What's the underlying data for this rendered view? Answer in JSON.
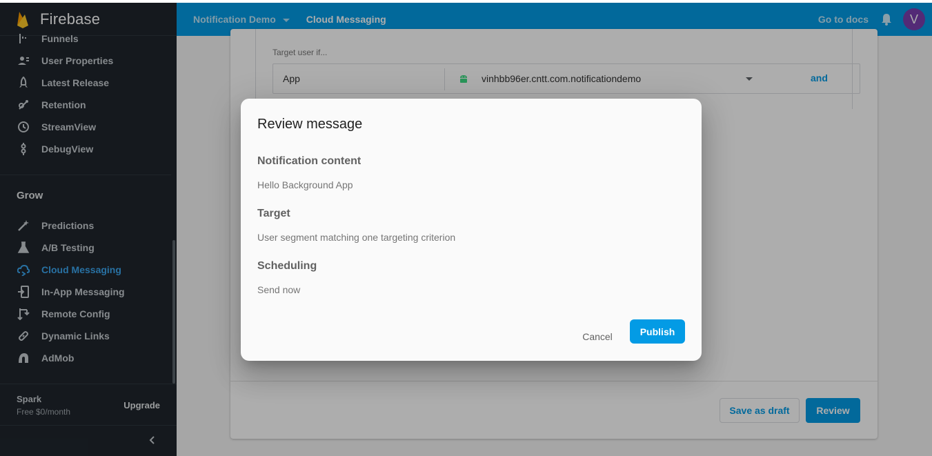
{
  "app": {
    "name": "Firebase"
  },
  "header": {
    "project": "Notification Demo",
    "breadcrumb": "Cloud Messaging",
    "docs_link": "Go to docs",
    "avatar_letter": "V"
  },
  "sidebar": {
    "items_top": [
      {
        "label": "Funnels",
        "icon": "funnel-icon"
      },
      {
        "label": "User Properties",
        "icon": "user-properties-icon"
      },
      {
        "label": "Latest Release",
        "icon": "rocket-icon"
      },
      {
        "label": "Retention",
        "icon": "retention-icon"
      },
      {
        "label": "StreamView",
        "icon": "clock-icon"
      },
      {
        "label": "DebugView",
        "icon": "debug-icon"
      }
    ],
    "grow_title": "Grow",
    "items_grow": [
      {
        "label": "Predictions",
        "icon": "magic-wand-icon"
      },
      {
        "label": "A/B Testing",
        "icon": "flask-icon"
      },
      {
        "label": "Cloud Messaging",
        "icon": "cloud-messaging-icon",
        "active": true
      },
      {
        "label": "In-App Messaging",
        "icon": "in-app-messaging-icon"
      },
      {
        "label": "Remote Config",
        "icon": "remote-config-icon"
      },
      {
        "label": "Dynamic Links",
        "icon": "link-icon"
      },
      {
        "label": "AdMob",
        "icon": "admob-icon"
      }
    ],
    "plan_name": "Spark",
    "plan_price": "Free $0/month",
    "upgrade_label": "Upgrade"
  },
  "targeting": {
    "label": "Target user if...",
    "field": "App",
    "app_package": "vinhbb96er.cntt.com.notificationdemo",
    "and_label": "and"
  },
  "footer_buttons": {
    "save_draft": "Save as draft",
    "review": "Review"
  },
  "dialog": {
    "title": "Review message",
    "sections": [
      {
        "heading": "Notification content",
        "value": "Hello Background App"
      },
      {
        "heading": "Target",
        "value": "User segment matching one targeting criterion"
      },
      {
        "heading": "Scheduling",
        "value": "Send now"
      }
    ],
    "cancel_label": "Cancel",
    "publish_label": "Publish"
  },
  "colors": {
    "accent": "#039be5",
    "sidebar_bg": "#1f262d",
    "active_item": "#3ca7f0",
    "avatar": "#7b3fae"
  }
}
